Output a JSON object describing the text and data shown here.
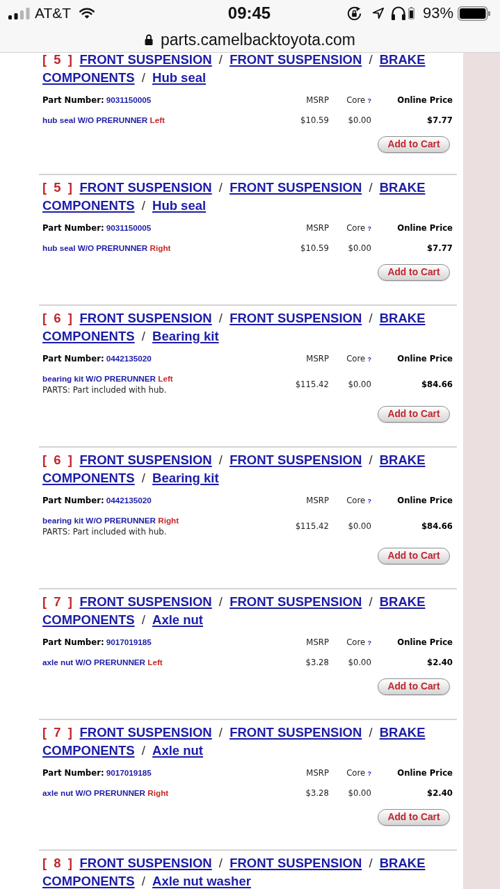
{
  "status_bar": {
    "carrier": "AT&T",
    "time": "09:45",
    "battery": "93%"
  },
  "address_bar": {
    "url": "parts.camelbacktoyota.com"
  },
  "parts": [
    {
      "title": [
        {
          "kind": "number",
          "text": "[ 5 ]"
        },
        {
          "kind": "link",
          "text": "FRONT SUSPENSION"
        },
        {
          "kind": "separator",
          "text": "/"
        },
        {
          "kind": "link",
          "text": "FRONT SUSPENSION"
        },
        {
          "kind": "separator",
          "text": "/"
        },
        {
          "kind": "link",
          "text": "BRAKE"
        },
        {
          "kind": "link",
          "text": "COMPONENTS"
        },
        {
          "kind": "separator",
          "text": "/"
        },
        {
          "kind": "link",
          "text": "Hub seal"
        }
      ],
      "part_number_label": "Part Number:",
      "part_number": "9031150005",
      "msrp_label": "MSRP",
      "core_label": "Core",
      "core_help": "?",
      "price_label": "Online Price",
      "description": "hub seal W/O PRERUNNER",
      "side": "Left",
      "msrp": "$10.59",
      "core": "$0.00",
      "price": "$7.77",
      "button": "Add to Cart"
    },
    {
      "title": [
        {
          "kind": "number",
          "text": "[ 5 ]"
        },
        {
          "kind": "link",
          "text": "FRONT SUSPENSION"
        },
        {
          "kind": "separator",
          "text": "/"
        },
        {
          "kind": "link",
          "text": "FRONT SUSPENSION"
        },
        {
          "kind": "separator",
          "text": "/"
        },
        {
          "kind": "link",
          "text": "BRAKE"
        },
        {
          "kind": "link",
          "text": "COMPONENTS"
        },
        {
          "kind": "separator",
          "text": "/"
        },
        {
          "kind": "link",
          "text": "Hub seal"
        }
      ],
      "part_number_label": "Part Number:",
      "part_number": "9031150005",
      "msrp_label": "MSRP",
      "core_label": "Core",
      "core_help": "?",
      "price_label": "Online Price",
      "description": "hub seal W/O PRERUNNER",
      "side": "Right",
      "msrp": "$10.59",
      "core": "$0.00",
      "price": "$7.77",
      "button": "Add to Cart"
    },
    {
      "title": [
        {
          "kind": "number",
          "text": "[ 6 ]"
        },
        {
          "kind": "link",
          "text": "FRONT SUSPENSION"
        },
        {
          "kind": "separator",
          "text": "/"
        },
        {
          "kind": "link",
          "text": "FRONT SUSPENSION"
        },
        {
          "kind": "separator",
          "text": "/"
        },
        {
          "kind": "link",
          "text": "BRAKE"
        },
        {
          "kind": "link",
          "text": "COMPONENTS"
        },
        {
          "kind": "separator",
          "text": "/"
        },
        {
          "kind": "link",
          "text": "Bearing kit"
        }
      ],
      "part_number_label": "Part Number:",
      "part_number": "0442135020",
      "msrp_label": "MSRP",
      "core_label": "Core",
      "core_help": "?",
      "price_label": "Online Price",
      "description": "bearing kit W/O PRERUNNER",
      "side": "Left",
      "note": "PARTS: Part included with hub.",
      "msrp": "$115.42",
      "core": "$0.00",
      "price": "$84.66",
      "button": "Add to Cart"
    },
    {
      "title": [
        {
          "kind": "number",
          "text": "[ 6 ]"
        },
        {
          "kind": "link",
          "text": "FRONT SUSPENSION"
        },
        {
          "kind": "separator",
          "text": "/"
        },
        {
          "kind": "link",
          "text": "FRONT SUSPENSION"
        },
        {
          "kind": "separator",
          "text": "/"
        },
        {
          "kind": "link",
          "text": "BRAKE"
        },
        {
          "kind": "link",
          "text": "COMPONENTS"
        },
        {
          "kind": "separator",
          "text": "/"
        },
        {
          "kind": "link",
          "text": "Bearing kit"
        }
      ],
      "part_number_label": "Part Number:",
      "part_number": "0442135020",
      "msrp_label": "MSRP",
      "core_label": "Core",
      "core_help": "?",
      "price_label": "Online Price",
      "description": "bearing kit W/O PRERUNNER",
      "side": "Right",
      "note": "PARTS: Part included with hub.",
      "msrp": "$115.42",
      "core": "$0.00",
      "price": "$84.66",
      "button": "Add to Cart"
    },
    {
      "title": [
        {
          "kind": "number",
          "text": "[ 7 ]"
        },
        {
          "kind": "link",
          "text": "FRONT SUSPENSION"
        },
        {
          "kind": "separator",
          "text": "/"
        },
        {
          "kind": "link",
          "text": "FRONT SUSPENSION"
        },
        {
          "kind": "separator",
          "text": "/"
        },
        {
          "kind": "link",
          "text": "BRAKE"
        },
        {
          "kind": "link",
          "text": "COMPONENTS"
        },
        {
          "kind": "separator",
          "text": "/"
        },
        {
          "kind": "link",
          "text": "Axle nut"
        }
      ],
      "part_number_label": "Part Number:",
      "part_number": "9017019185",
      "msrp_label": "MSRP",
      "core_label": "Core",
      "core_help": "?",
      "price_label": "Online Price",
      "description": "axle nut W/O PRERUNNER",
      "side": "Left",
      "msrp": "$3.28",
      "core": "$0.00",
      "price": "$2.40",
      "button": "Add to Cart"
    },
    {
      "title": [
        {
          "kind": "number",
          "text": "[ 7 ]"
        },
        {
          "kind": "link",
          "text": "FRONT SUSPENSION"
        },
        {
          "kind": "separator",
          "text": "/"
        },
        {
          "kind": "link",
          "text": "FRONT SUSPENSION"
        },
        {
          "kind": "separator",
          "text": "/"
        },
        {
          "kind": "link",
          "text": "BRAKE"
        },
        {
          "kind": "link",
          "text": "COMPONENTS"
        },
        {
          "kind": "separator",
          "text": "/"
        },
        {
          "kind": "link",
          "text": "Axle nut"
        }
      ],
      "part_number_label": "Part Number:",
      "part_number": "9017019185",
      "msrp_label": "MSRP",
      "core_label": "Core",
      "core_help": "?",
      "price_label": "Online Price",
      "description": "axle nut W/O PRERUNNER",
      "side": "Right",
      "msrp": "$3.28",
      "core": "$0.00",
      "price": "$2.40",
      "button": "Add to Cart"
    },
    {
      "title": [
        {
          "kind": "number",
          "text": "[ 8 ]"
        },
        {
          "kind": "link",
          "text": "FRONT SUSPENSION"
        },
        {
          "kind": "separator",
          "text": "/"
        },
        {
          "kind": "link",
          "text": "FRONT SUSPENSION"
        },
        {
          "kind": "separator",
          "text": "/"
        },
        {
          "kind": "link",
          "text": "BRAKE"
        },
        {
          "kind": "link",
          "text": "COMPONENTS"
        },
        {
          "kind": "separator",
          "text": "/"
        },
        {
          "kind": "link",
          "text": "Axle nut washer"
        }
      ]
    }
  ]
}
